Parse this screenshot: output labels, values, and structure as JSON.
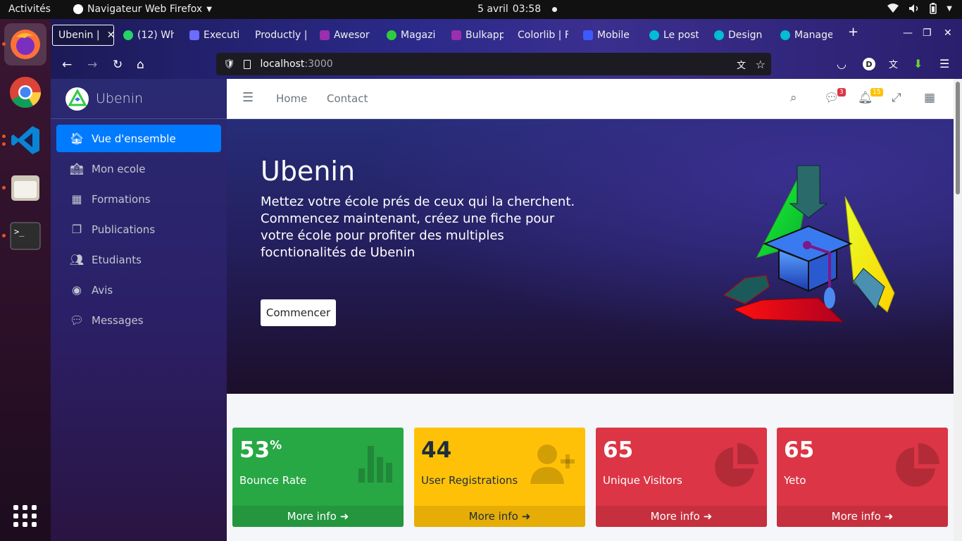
{
  "system": {
    "activities": "Activités",
    "app_menu": "Navigateur Web Firefox",
    "date": "5 avril",
    "time": "03:58"
  },
  "browser": {
    "tabs": [
      {
        "label": "Ubenin |",
        "color": "#ffffff"
      },
      {
        "label": "(12) Wh",
        "color": "#25d366"
      },
      {
        "label": "Executi",
        "color": "#6c6cff"
      },
      {
        "label": "Productly |",
        "color": "#333333"
      },
      {
        "label": "Awesor",
        "color": "#9b2fae"
      },
      {
        "label": "Magazi",
        "color": "#2ecc40"
      },
      {
        "label": "Bulkapp",
        "color": "#9b2fae"
      },
      {
        "label": "Colorlib | F",
        "color": "#333333"
      },
      {
        "label": "Mobile",
        "color": "#3d5afe"
      },
      {
        "label": "Le post",
        "color": "#00bcd4"
      },
      {
        "label": "Design",
        "color": "#00bcd4"
      },
      {
        "label": "Manage",
        "color": "#00bcd4"
      }
    ],
    "url_host": "localhost",
    "url_port": ":3000",
    "profile_initial": "D"
  },
  "sidebar": {
    "brand": "Ubenin",
    "items": [
      {
        "label": "Vue d'ensemble",
        "icon": "home-icon"
      },
      {
        "label": "Mon ecole",
        "icon": "school-icon"
      },
      {
        "label": "Formations",
        "icon": "grid-icon"
      },
      {
        "label": "Publications",
        "icon": "copy-icon"
      },
      {
        "label": "Etudiants",
        "icon": "users-icon"
      },
      {
        "label": "Avis",
        "icon": "dot-circle-icon"
      },
      {
        "label": "Messages",
        "icon": "comments-icon"
      }
    ]
  },
  "header": {
    "links": [
      "Home",
      "Contact"
    ],
    "messages_badge": "3",
    "notifications_badge": "15"
  },
  "hero": {
    "title": "Ubenin",
    "text": "Mettez votre école prés de ceux qui la cherchent. Commencez maintenant, créez une fiche pour votre école pour profiter des multiples focntionalités de Ubenin",
    "button": "Commencer"
  },
  "stats": [
    {
      "value": "53",
      "sup": "%",
      "label": "Bounce Rate",
      "more": "More info",
      "color": "#28a745",
      "footer_color": "#23963e",
      "icon": "bar-chart-icon"
    },
    {
      "value": "44",
      "sup": "",
      "label": "User Registrations",
      "more": "More info",
      "color": "#ffc107",
      "footer_color": "#e5ad06",
      "icon": "user-plus-icon"
    },
    {
      "value": "65",
      "sup": "",
      "label": "Unique Visitors",
      "more": "More info",
      "color": "#dc3545",
      "footer_color": "#c62f3e",
      "icon": "pie-chart-icon"
    },
    {
      "value": "65",
      "sup": "",
      "label": "Yeto",
      "more": "More info",
      "color": "#dc3545",
      "footer_color": "#c62f3e",
      "icon": "pie-chart-icon"
    }
  ]
}
